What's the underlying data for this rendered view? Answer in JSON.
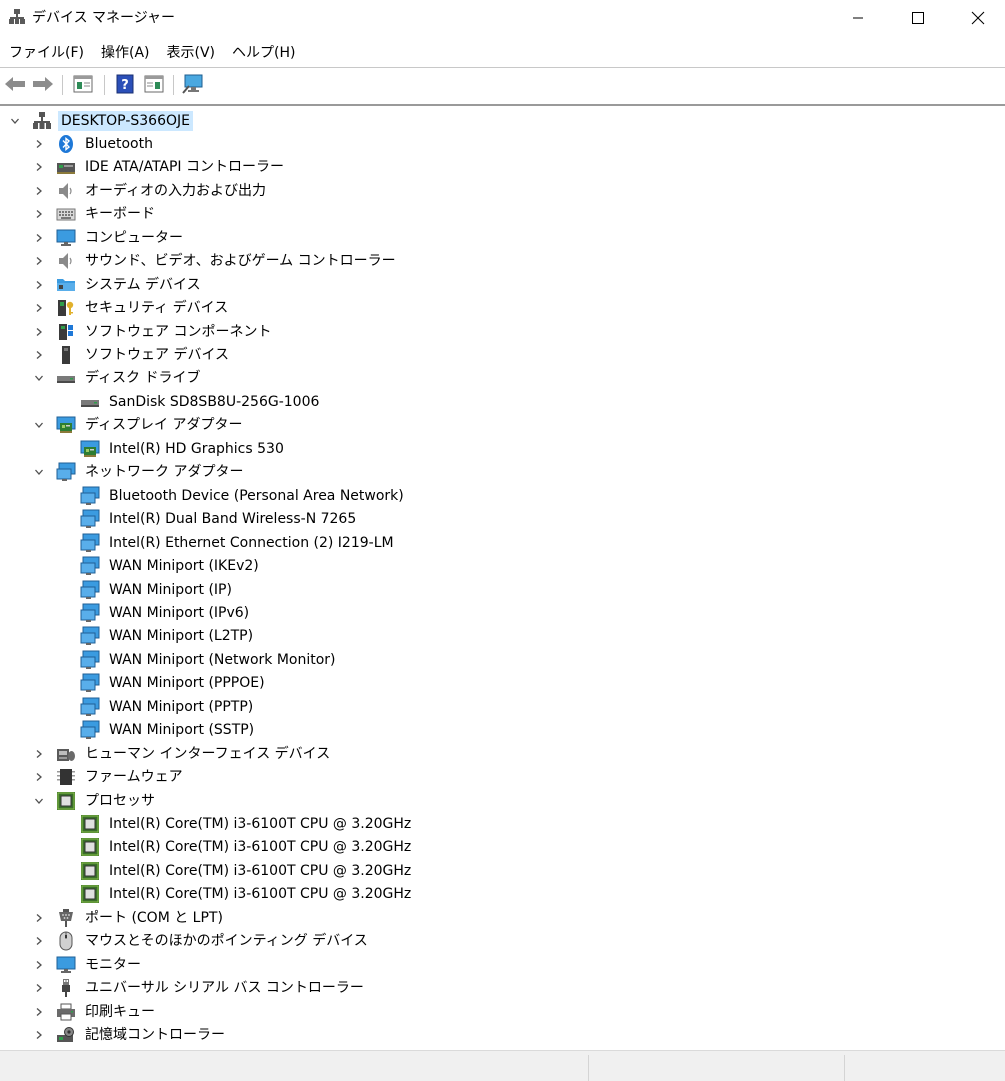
{
  "window": {
    "title": "デバイス マネージャー",
    "icon": "device-manager-icon"
  },
  "menu": [
    {
      "label": "ファイル(F)",
      "name": "menu-file"
    },
    {
      "label": "操作(A)",
      "name": "menu-action"
    },
    {
      "label": "表示(V)",
      "name": "menu-view"
    },
    {
      "label": "ヘルプ(H)",
      "name": "menu-help"
    }
  ],
  "toolbar": [
    "back-arrow-icon",
    "forward-arrow-icon",
    "properties-icon",
    "help-icon",
    "update-driver-icon",
    "scan-hardware-icon"
  ],
  "tree": [
    {
      "label": "DESKTOP-S366OJE",
      "level": 0,
      "expanded": true,
      "selected": true,
      "icon": "computer-network-icon"
    },
    {
      "label": "Bluetooth",
      "level": 1,
      "expanded": false,
      "icon": "bluetooth-icon"
    },
    {
      "label": "IDE ATA/ATAPI コントローラー",
      "level": 1,
      "expanded": false,
      "icon": "ide-controller-icon"
    },
    {
      "label": "オーディオの入力および出力",
      "level": 1,
      "expanded": false,
      "icon": "speaker-icon"
    },
    {
      "label": "キーボード",
      "level": 1,
      "expanded": false,
      "icon": "keyboard-icon"
    },
    {
      "label": "コンピューター",
      "level": 1,
      "expanded": false,
      "icon": "monitor-icon"
    },
    {
      "label": "サウンド、ビデオ、およびゲーム コントローラー",
      "level": 1,
      "expanded": false,
      "icon": "speaker-icon"
    },
    {
      "label": "システム デバイス",
      "level": 1,
      "expanded": false,
      "icon": "folder-icon"
    },
    {
      "label": "セキュリティ デバイス",
      "level": 1,
      "expanded": false,
      "icon": "security-key-icon"
    },
    {
      "label": "ソフトウェア コンポーネント",
      "level": 1,
      "expanded": false,
      "icon": "software-component-icon"
    },
    {
      "label": "ソフトウェア デバイス",
      "level": 1,
      "expanded": false,
      "icon": "software-device-icon"
    },
    {
      "label": "ディスク ドライブ",
      "level": 1,
      "expanded": true,
      "icon": "disk-drive-icon"
    },
    {
      "label": "SanDisk SD8SB8U-256G-1006",
      "level": 2,
      "icon": "disk-drive-icon"
    },
    {
      "label": "ディスプレイ アダプター",
      "level": 1,
      "expanded": true,
      "icon": "display-adapter-icon"
    },
    {
      "label": "Intel(R) HD Graphics 530",
      "level": 2,
      "icon": "display-adapter-icon"
    },
    {
      "label": "ネットワーク アダプター",
      "level": 1,
      "expanded": true,
      "icon": "network-adapter-icon"
    },
    {
      "label": "Bluetooth Device (Personal Area Network)",
      "level": 2,
      "icon": "network-adapter-icon"
    },
    {
      "label": "Intel(R) Dual Band Wireless-N 7265",
      "level": 2,
      "icon": "network-adapter-icon"
    },
    {
      "label": "Intel(R) Ethernet Connection (2) I219-LM",
      "level": 2,
      "icon": "network-adapter-icon"
    },
    {
      "label": "WAN Miniport (IKEv2)",
      "level": 2,
      "icon": "network-adapter-icon"
    },
    {
      "label": "WAN Miniport (IP)",
      "level": 2,
      "icon": "network-adapter-icon"
    },
    {
      "label": "WAN Miniport (IPv6)",
      "level": 2,
      "icon": "network-adapter-icon"
    },
    {
      "label": "WAN Miniport (L2TP)",
      "level": 2,
      "icon": "network-adapter-icon"
    },
    {
      "label": "WAN Miniport (Network Monitor)",
      "level": 2,
      "icon": "network-adapter-icon"
    },
    {
      "label": "WAN Miniport (PPPOE)",
      "level": 2,
      "icon": "network-adapter-icon"
    },
    {
      "label": "WAN Miniport (PPTP)",
      "level": 2,
      "icon": "network-adapter-icon"
    },
    {
      "label": "WAN Miniport (SSTP)",
      "level": 2,
      "icon": "network-adapter-icon"
    },
    {
      "label": "ヒューマン インターフェイス デバイス",
      "level": 1,
      "expanded": false,
      "icon": "hid-icon"
    },
    {
      "label": "ファームウェア",
      "level": 1,
      "expanded": false,
      "icon": "firmware-icon"
    },
    {
      "label": "プロセッサ",
      "level": 1,
      "expanded": true,
      "icon": "processor-icon"
    },
    {
      "label": "Intel(R) Core(TM) i3-6100T CPU @ 3.20GHz",
      "level": 2,
      "icon": "processor-icon"
    },
    {
      "label": "Intel(R) Core(TM) i3-6100T CPU @ 3.20GHz",
      "level": 2,
      "icon": "processor-icon"
    },
    {
      "label": "Intel(R) Core(TM) i3-6100T CPU @ 3.20GHz",
      "level": 2,
      "icon": "processor-icon"
    },
    {
      "label": "Intel(R) Core(TM) i3-6100T CPU @ 3.20GHz",
      "level": 2,
      "icon": "processor-icon"
    },
    {
      "label": "ポート (COM と LPT)",
      "level": 1,
      "expanded": false,
      "icon": "port-icon"
    },
    {
      "label": "マウスとそのほかのポインティング デバイス",
      "level": 1,
      "expanded": false,
      "icon": "mouse-icon"
    },
    {
      "label": "モニター",
      "level": 1,
      "expanded": false,
      "icon": "monitor-icon"
    },
    {
      "label": "ユニバーサル シリアル バス コントローラー",
      "level": 1,
      "expanded": false,
      "icon": "usb-icon"
    },
    {
      "label": "印刷キュー",
      "level": 1,
      "expanded": false,
      "icon": "printer-icon"
    },
    {
      "label": "記憶域コントローラー",
      "level": 1,
      "expanded": false,
      "icon": "storage-controller-icon"
    }
  ]
}
